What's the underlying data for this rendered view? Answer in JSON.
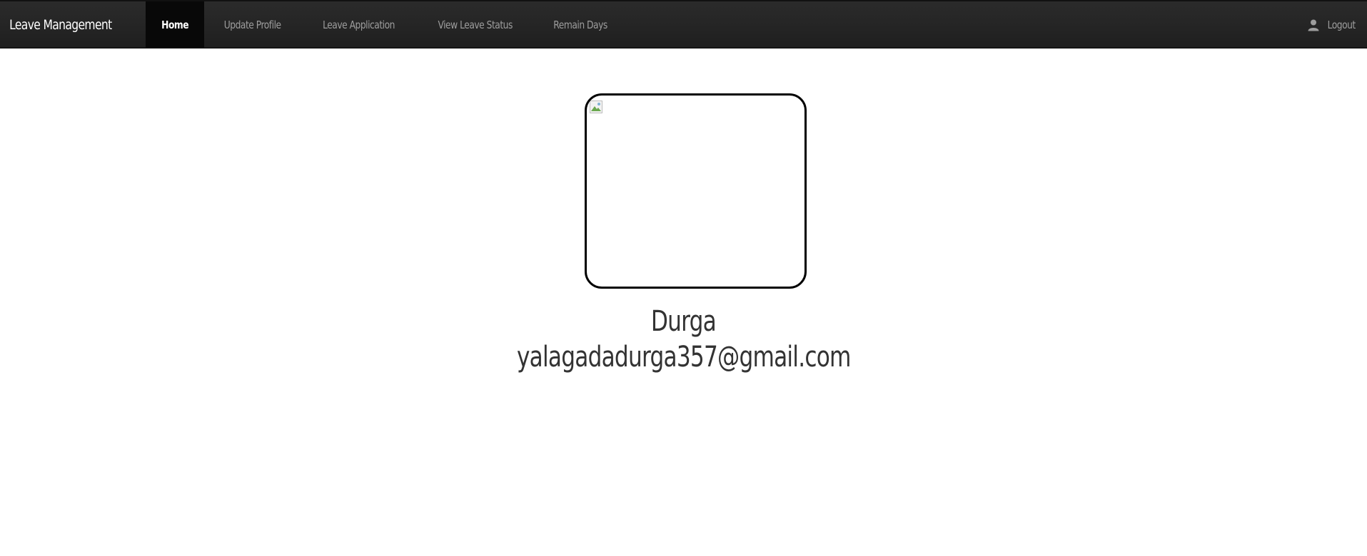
{
  "navbar": {
    "brand": "Leave Management",
    "items": [
      {
        "label": "Home",
        "active": true
      },
      {
        "label": "Update Profile",
        "active": false
      },
      {
        "label": "Leave Application",
        "active": false
      },
      {
        "label": "View Leave Status",
        "active": false
      },
      {
        "label": "Remain Days",
        "active": false
      }
    ],
    "logout_label": "Logout",
    "logout_icon": "user-icon"
  },
  "profile": {
    "photo_icon": "broken-image-icon",
    "name": "Durga",
    "email": "yalagadadurga357@gmail.com"
  },
  "colors": {
    "navbar_bg": "#222222",
    "active_bg": "#080808",
    "nav_text": "#9d9d9d",
    "body_text": "#333333"
  }
}
